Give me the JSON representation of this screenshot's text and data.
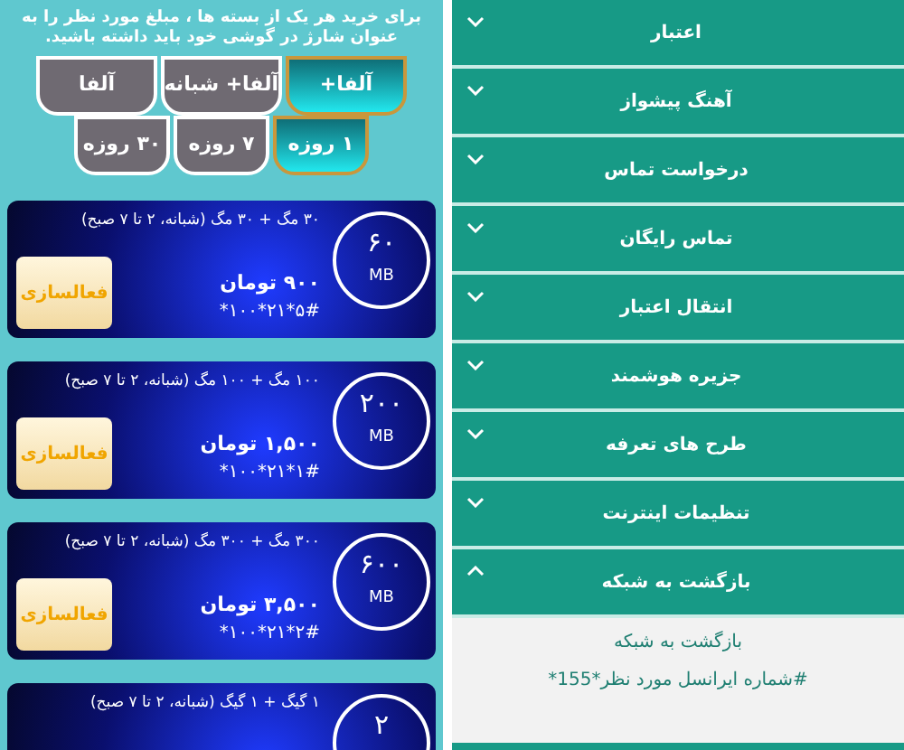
{
  "notice": "برای خرید هر یک از بسته ها ، مبلغ مورد نظر را به عنوان شارژ در گوشی خود باید داشته باشید.",
  "plan_tabs": [
    {
      "label": "آلفا+",
      "selected": true
    },
    {
      "label": "آلفا+ شبانه",
      "selected": false
    },
    {
      "label": "آلفا",
      "selected": false
    }
  ],
  "duration_tabs": [
    {
      "label": "۱ روزه",
      "selected": true
    },
    {
      "label": "۷ روزه",
      "selected": false
    },
    {
      "label": "۳۰ روزه",
      "selected": false
    }
  ],
  "packages": [
    {
      "size": "۶۰",
      "unit": "MB",
      "description": "۳۰ مگ + ۳۰ مگ (شبانه، ۲ تا ۷ صبح)",
      "price": "۹۰۰ تومان",
      "code": "*۱۰۰*۲۱*۵#",
      "button": "فعالسازی"
    },
    {
      "size": "۲۰۰",
      "unit": "MB",
      "description": "۱۰۰ مگ + ۱۰۰ مگ (شبانه، ۲ تا ۷ صبح)",
      "price": "۱,۵۰۰ تومان",
      "code": "*۱۰۰*۲۱*۱#",
      "button": "فعالسازی"
    },
    {
      "size": "۶۰۰",
      "unit": "MB",
      "description": "۳۰۰ مگ + ۳۰۰ مگ (شبانه، ۲ تا ۷ صبح)",
      "price": "۳,۵۰۰ تومان",
      "code": "*۱۰۰*۲۱*۲#",
      "button": "فعالسازی"
    },
    {
      "size": "۲",
      "description": "۱ گیگ + ۱ گیگ (شبانه، ۲ تا ۷ صبح)"
    }
  ],
  "menu": [
    {
      "label": "اعتبار",
      "expanded": false
    },
    {
      "label": "آهنگ پیشواز",
      "expanded": false
    },
    {
      "label": "درخواست تماس",
      "expanded": false
    },
    {
      "label": "تماس رایگان",
      "expanded": false
    },
    {
      "label": "انتقال اعتبار",
      "expanded": false
    },
    {
      "label": "جزیره هوشمند",
      "expanded": false
    },
    {
      "label": "طرح های تعرفه",
      "expanded": false
    },
    {
      "label": "تنظیمات اینترنت",
      "expanded": false
    },
    {
      "label": "بازگشت به شبکه",
      "expanded": true,
      "content": [
        "بازگشت به شبکه",
        "#شماره ایرانسل مورد نظر*155*"
      ]
    }
  ]
}
